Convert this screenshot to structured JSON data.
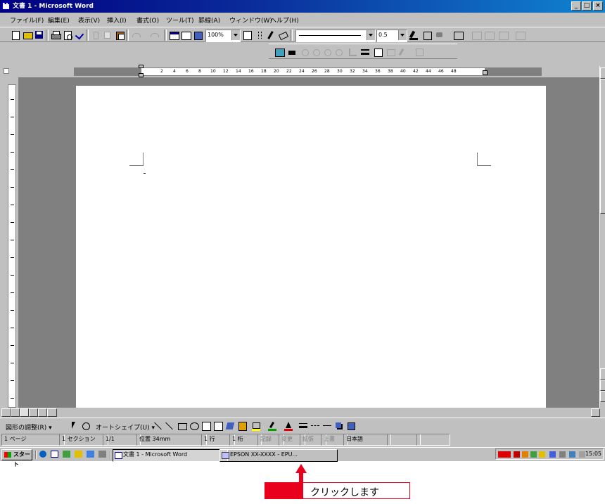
{
  "window": {
    "title": "文書 1 - Microsoft Word",
    "controls": [
      "_",
      "□",
      "×"
    ]
  },
  "menubar": {
    "items": [
      "ファイル(F)",
      "編集(E)",
      "表示(V)",
      "挿入(I)",
      "書式(O)",
      "ツール(T)",
      "罫線(A)",
      "ウィンドウ(W)",
      "ヘルプ(H)"
    ]
  },
  "toolbar": {
    "zoom": "100%",
    "line_weight": "0.5"
  },
  "ruler": {
    "numbers": [
      "2",
      "4",
      "6",
      "8",
      "10",
      "12",
      "14",
      "16",
      "18",
      "20",
      "22",
      "24",
      "26",
      "28",
      "30",
      "32",
      "34",
      "36",
      "38",
      "40",
      "42",
      "44",
      "46",
      "48"
    ]
  },
  "drawing_toolbar": {
    "draw_menu": "図形の調整(R) ▾",
    "autoshapes": "オートシェイプ(U) ▾"
  },
  "statusbar": {
    "page": "1 ページ",
    "section": "1 セクション",
    "page_of": "1/1",
    "position": "位置 34mm",
    "line": "1 行",
    "column": "1 桁",
    "rec": "記録",
    "trk": "変更",
    "ext": "拡張",
    "ovr": "上書",
    "language": "日本語"
  },
  "taskbar": {
    "start": "スタート",
    "tasks": [
      "文書 1 - Microsoft Word",
      "EPSON XX-XXXX - EPU..."
    ],
    "clock": "15:05"
  },
  "annotation": {
    "text": "クリックします",
    "accent_color": "#e8001c"
  }
}
